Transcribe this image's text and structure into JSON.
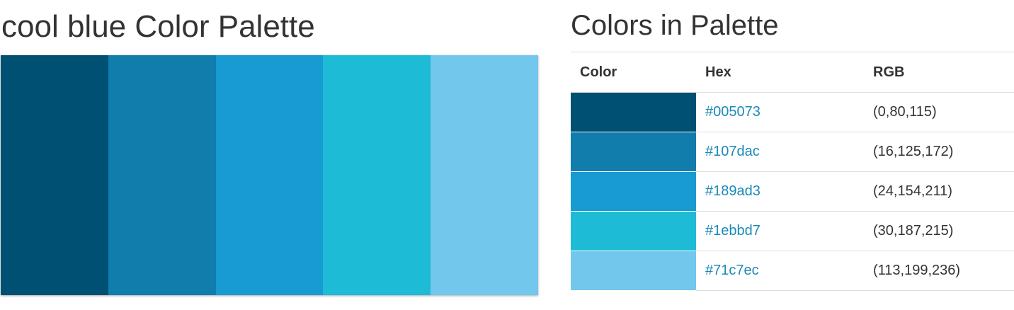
{
  "palette": {
    "title": "cool blue Color Palette",
    "colors": [
      {
        "hex": "#005073",
        "rgb": "(0,80,115)"
      },
      {
        "hex": "#107dac",
        "rgb": "(16,125,172)"
      },
      {
        "hex": "#189ad3",
        "rgb": "(24,154,211)"
      },
      {
        "hex": "#1ebbd7",
        "rgb": "(30,187,215)"
      },
      {
        "hex": "#71c7ec",
        "rgb": "(113,199,236)"
      }
    ]
  },
  "table": {
    "title": "Colors in Palette",
    "headers": {
      "color": "Color",
      "hex": "Hex",
      "rgb": "RGB"
    }
  }
}
